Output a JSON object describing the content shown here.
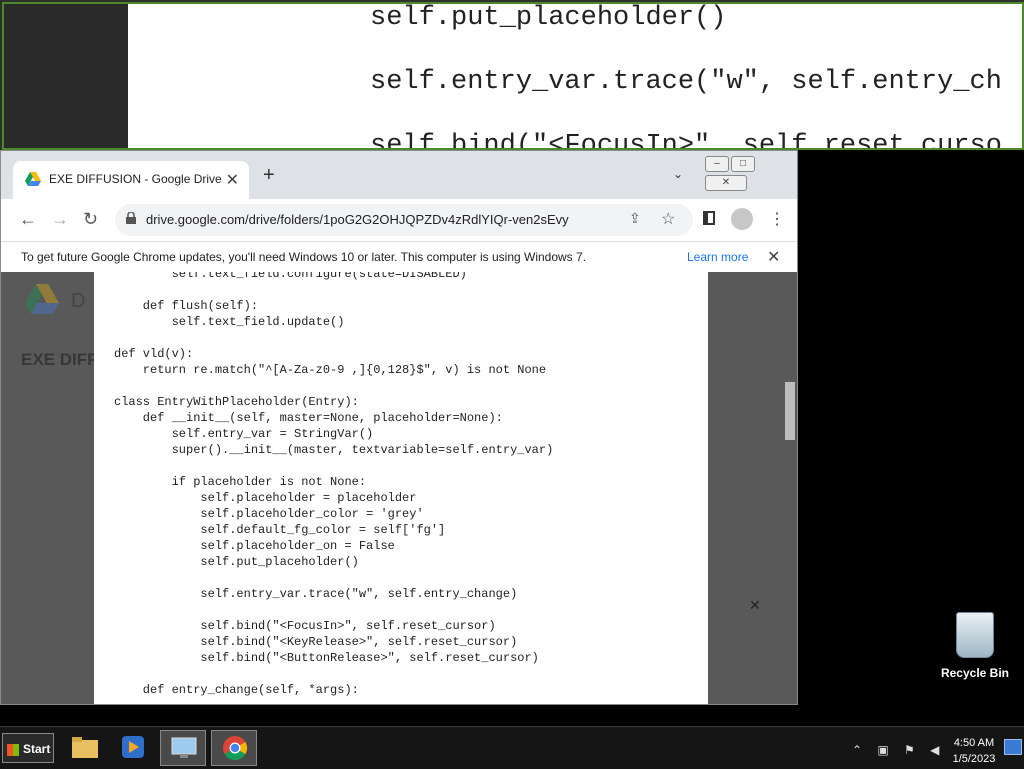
{
  "magnifier": {
    "code_lines": [
      "self.put_placeholder()",
      "self.entry_var.trace(\"w\", self.entry_ch",
      "self.bind(\"<FocusIn>\", self.reset_curso"
    ]
  },
  "browser": {
    "tab": {
      "title": "EXE DIFFUSION - Google Drive",
      "close": "✕"
    },
    "new_tab": "+",
    "url": "drive.google.com/drive/folders/1poG2G2OHJQPZDv4zRdlYIQr-ven2sEvy",
    "infobar": {
      "message": "To get future Google Chrome updates, you'll need Windows 10 or later. This computer is using Windows 7.",
      "link": "Learn more",
      "close": "✕"
    },
    "drive": {
      "app_letter": "D",
      "folder_title": "EXE DIFF"
    },
    "code_lines": [
      "        self.text_field.configure(state=DISABLED)",
      "",
      "    def flush(self):",
      "        self.text_field.update()",
      "",
      "def vld(v):",
      "    return re.match(\"^[A-Za-z0-9 ,]{0,128}$\", v) is not None",
      "",
      "class EntryWithPlaceholder(Entry):",
      "    def __init__(self, master=None, placeholder=None):",
      "        self.entry_var = StringVar()",
      "        super().__init__(master, textvariable=self.entry_var)",
      "",
      "        if placeholder is not None:",
      "            self.placeholder = placeholder",
      "            self.placeholder_color = 'grey'",
      "            self.default_fg_color = self['fg']",
      "            self.placeholder_on = False",
      "            self.put_placeholder()",
      "",
      "            self.entry_var.trace(\"w\", self.entry_change)",
      "",
      "            self.bind(\"<FocusIn>\", self.reset_cursor)",
      "            self.bind(\"<KeyRelease>\", self.reset_cursor)",
      "            self.bind(\"<ButtonRelease>\", self.reset_cursor)",
      "",
      "    def entry_change(self, *args):"
    ],
    "preview_close": "✕"
  },
  "desktop": {
    "recycle_bin_label": "Recycle Bin"
  },
  "taskbar": {
    "start_label": "Start",
    "time": "4:50 AM",
    "date": "1/5/2023"
  }
}
